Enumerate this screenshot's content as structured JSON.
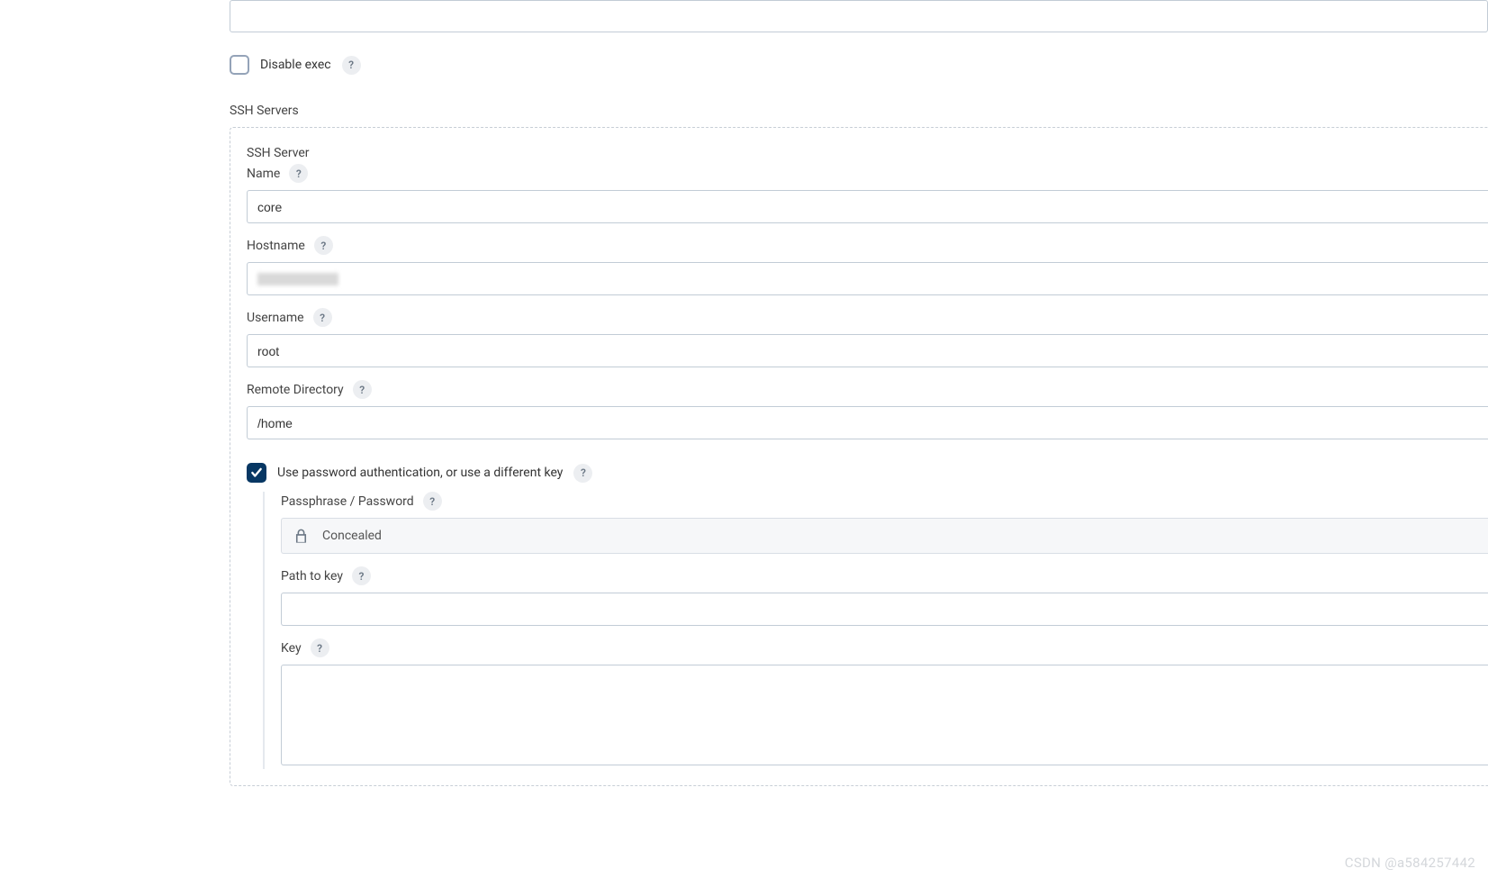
{
  "disableExec": {
    "label": "Disable exec",
    "checked": false
  },
  "sectionTitle": "SSH Servers",
  "server": {
    "title": "SSH Server",
    "name": {
      "label": "Name",
      "value": "core"
    },
    "host": {
      "label": "Hostname",
      "value": ""
    },
    "user": {
      "label": "Username",
      "value": "root"
    },
    "remote": {
      "label": "Remote Directory",
      "value": "/home"
    },
    "auth": {
      "label": "Use password authentication, or use a different key",
      "checked": true,
      "passphrase": {
        "label": "Passphrase / Password",
        "concealedText": "Concealed"
      },
      "pathToKey": {
        "label": "Path to key",
        "value": ""
      },
      "key": {
        "label": "Key",
        "value": ""
      }
    }
  },
  "helpGlyph": "?",
  "watermark": "CSDN @a584257442"
}
